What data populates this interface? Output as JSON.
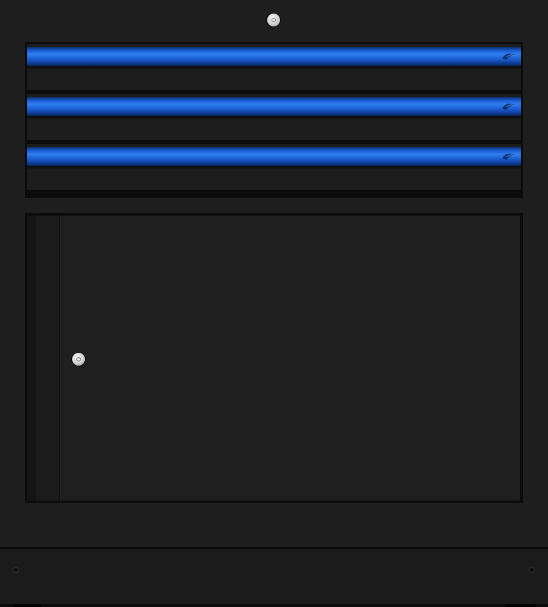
{
  "cabinet": {
    "drawers": [
      {
        "handle_color": "#1f63d6",
        "logo_icon": "brand-logo-icon"
      },
      {
        "handle_color": "#1f63d6",
        "logo_icon": "brand-logo-icon"
      },
      {
        "handle_color": "#1f63d6",
        "logo_icon": "brand-logo-icon"
      }
    ],
    "door": {
      "side": "left-hinged",
      "lock_icon": "lock-icon"
    },
    "top_lock_icon": "lock-icon",
    "colors": {
      "body": "#1e1e1e",
      "accent": "#1f63d6"
    }
  }
}
